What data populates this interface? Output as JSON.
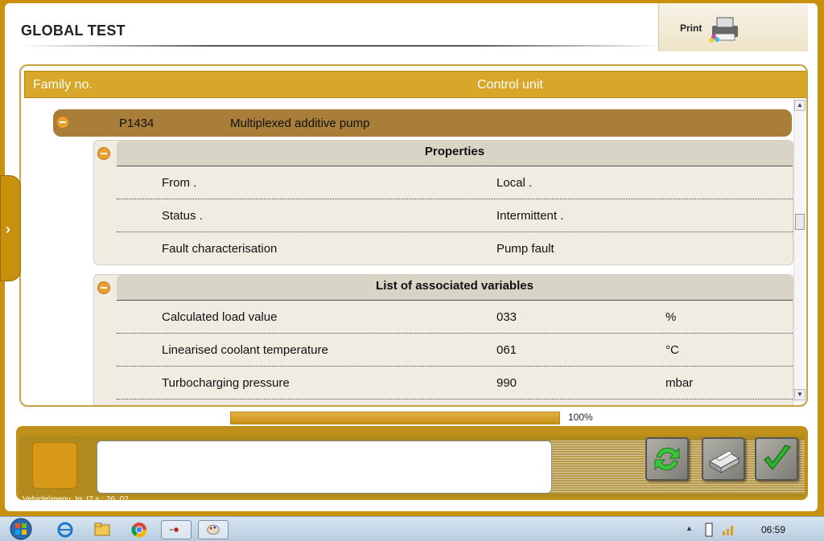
{
  "window": {
    "title": "GLOBAL TEST",
    "print_label": "Print"
  },
  "table_header": {
    "family_no": "Family no.",
    "control_unit": "Control unit"
  },
  "fault": {
    "code": "P1434",
    "description": "Multiplexed additive pump"
  },
  "properties": {
    "title": "Properties",
    "rows": [
      {
        "label": "From .",
        "value": "Local ."
      },
      {
        "label": "Status .",
        "value": "Intermittent ."
      },
      {
        "label": "Fault characterisation",
        "value": "Pump fault"
      }
    ]
  },
  "variables": {
    "title": "List of associated variables",
    "rows": [
      {
        "label": "Calculated load value",
        "value": "033",
        "unit": "%"
      },
      {
        "label": "Linearised coolant temperature",
        "value": "061",
        "unit": "°C"
      },
      {
        "label": "Turbocharging pressure",
        "value": "990",
        "unit": "mbar"
      }
    ]
  },
  "progress": {
    "value": 100,
    "text": "100%"
  },
  "status_bar": {
    "path": "Vehicle\\menu_tg_t7.s : 26_02"
  },
  "taskbar": {
    "clock": "06:59"
  },
  "colors": {
    "frame": "#c8900c",
    "header": "#d8a628",
    "fault_row": "#a87e38",
    "section_head": "#d9d5c6"
  }
}
